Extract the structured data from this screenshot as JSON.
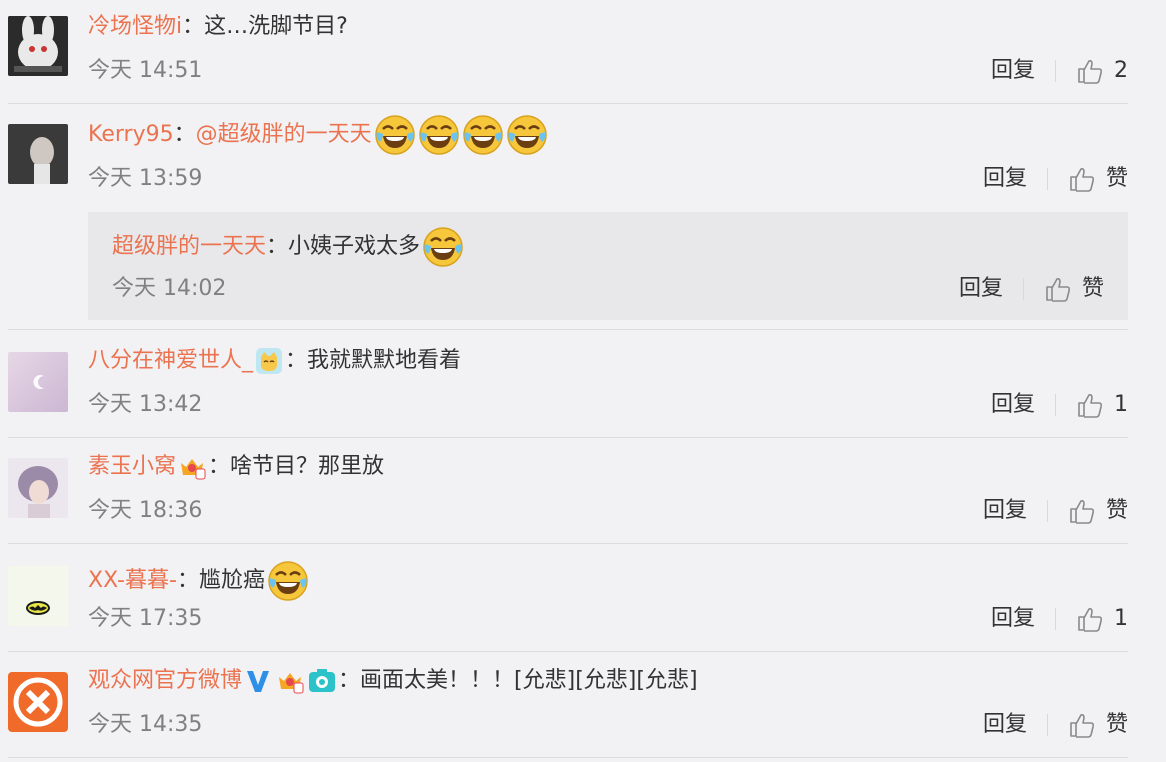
{
  "comments": [
    {
      "user": "冷场怪物i",
      "colon": "：",
      "text": "这…洗脚节目?",
      "time": "今天 14:51",
      "reply": "回复",
      "like": "2"
    },
    {
      "user": "Kerry95",
      "colon": "：",
      "text": "@超级胖的一天天",
      "time": "今天 13:59",
      "reply": "回复",
      "like": "赞"
    },
    {
      "user": "超级胖的一天天",
      "colon": "：",
      "text": "小姨子戏太多",
      "time": "今天 14:02",
      "reply": "回复",
      "like": "赞"
    },
    {
      "user": "八分在神爱世人_",
      "colon": "：",
      "text": "我就默默地看着",
      "time": "今天 13:42",
      "reply": "回复",
      "like": "1"
    },
    {
      "user": "素玉小窝",
      "colon": "：",
      "text": "啥节目？那里放",
      "time": "今天 18:36",
      "reply": "回复",
      "like": "赞"
    },
    {
      "user": "XX-暮暮-",
      "colon": "：",
      "text": "尴尬癌",
      "time": "今天 17:35",
      "reply": "回复",
      "like": "1"
    },
    {
      "user": "观众网官方微博",
      "colon": "：",
      "text": "画面太美！！！[允悲][允悲][允悲]",
      "time": "今天 14:35",
      "reply": "回复",
      "like": "赞"
    }
  ],
  "colors": {
    "username": "#eb7350",
    "time": "#808080",
    "background": "#f2f2f5"
  },
  "icons": [
    "laugh-cry-emoji",
    "thumbs-up-icon",
    "verified-v-icon",
    "crown-badge-icon",
    "cat-emoji",
    "camera-badge-icon"
  ]
}
